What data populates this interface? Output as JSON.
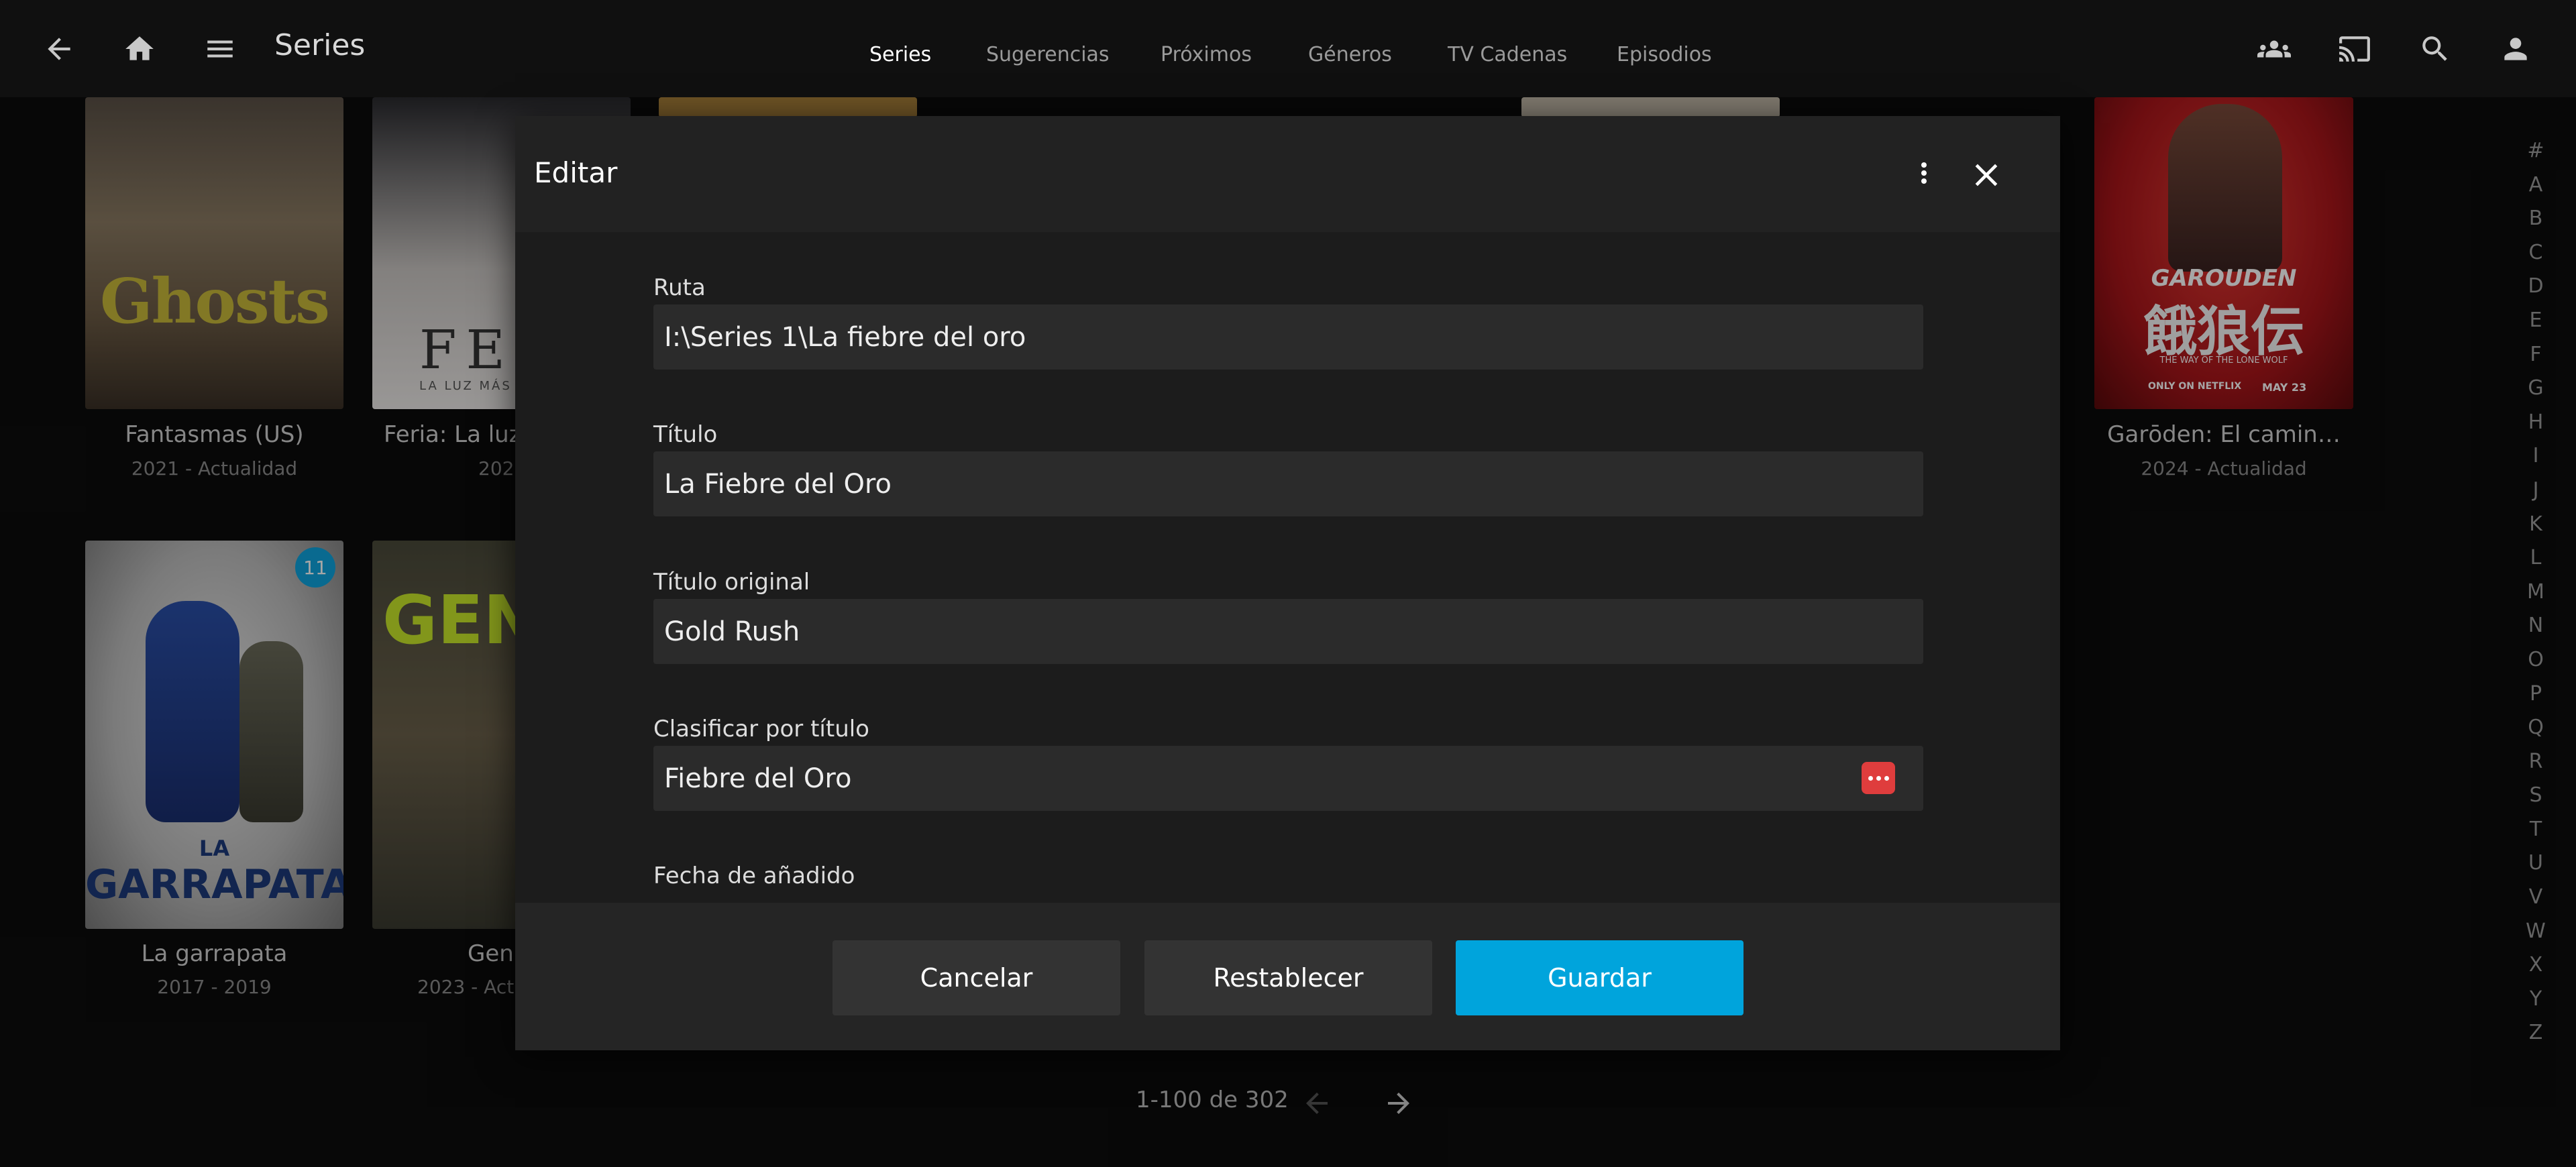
{
  "header": {
    "title": "Series",
    "tabs": [
      {
        "label": "Series",
        "active": true
      },
      {
        "label": "Sugerencias",
        "active": false
      },
      {
        "label": "Próximos",
        "active": false
      },
      {
        "label": "Géneros",
        "active": false
      },
      {
        "label": "TV Cadenas",
        "active": false
      },
      {
        "label": "Episodios",
        "active": false
      }
    ],
    "icons": [
      "back-arrow-icon",
      "home-icon",
      "menu-icon",
      "users-icon",
      "cast-icon",
      "search-icon",
      "user-icon"
    ]
  },
  "grid": {
    "cards": [
      {
        "title": "Fantasmas (US)",
        "year": "2021 - Actualidad",
        "poster_text": "Ghosts"
      },
      {
        "title": "Feria: La luz",
        "year": "202",
        "poster_text": "FER",
        "poster_subtext": "LA LUZ MÁS"
      },
      {
        "title": "Garōden: El camin…",
        "year": "2024 - Actualidad",
        "poster_text": "GAROUDEN",
        "poster_kanji": "餓狼伝",
        "poster_tagline": "THE WAY OF THE LONE WOLF",
        "poster_netflix": "ONLY ON NETFLIX",
        "poster_date": "MAY 23"
      },
      {
        "title": "La garrapata",
        "year": "2017 - 2019",
        "poster_text": "LA",
        "poster_text2": "GARRAPATA",
        "badge": "11"
      },
      {
        "title": "Gen",
        "year": "2023 - Act",
        "poster_text": "GEN"
      }
    ]
  },
  "alphabet": [
    "#",
    "A",
    "B",
    "C",
    "D",
    "E",
    "F",
    "G",
    "H",
    "I",
    "J",
    "K",
    "L",
    "M",
    "N",
    "O",
    "P",
    "Q",
    "R",
    "S",
    "T",
    "U",
    "V",
    "W",
    "X",
    "Y",
    "Z"
  ],
  "pager": {
    "text": "1-100 de 302"
  },
  "dialog": {
    "title": "Editar",
    "fields": [
      {
        "label": "Ruta",
        "value": "I:\\Series 1\\La fiebre del oro"
      },
      {
        "label": "Título",
        "value": "La Fiebre del Oro"
      },
      {
        "label": "Título original",
        "value": "Gold Rush"
      },
      {
        "label": "Clasificar por título",
        "value": "Fiebre del Oro"
      },
      {
        "label": "Fecha de añadido",
        "value": ""
      }
    ],
    "buttons": {
      "cancel": "Cancelar",
      "reset": "Restablecer",
      "save": "Guardar"
    }
  },
  "colors": {
    "accent": "#00a4dc",
    "badge": "#0fa4dd",
    "dots_button": "#df3d3d"
  }
}
